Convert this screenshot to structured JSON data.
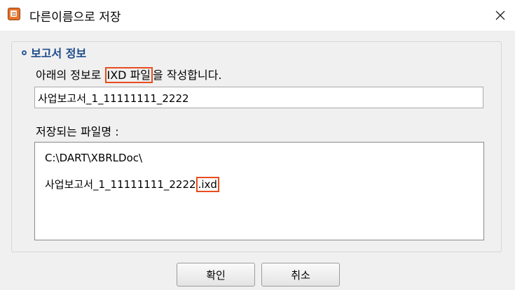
{
  "window": {
    "title": "다른이름으로 저장"
  },
  "group": {
    "label": "보고서 정보"
  },
  "description": {
    "prefix": "아래의 정보로 ",
    "highlight": "IXD 파일",
    "suffix": "을 작성합니다."
  },
  "report_name_field": {
    "value": "사업보고서_1_11111111_2222"
  },
  "saved_file": {
    "label": "저장되는 파일명 :",
    "path": "C:\\DART\\XBRLDoc\\",
    "name": "사업보고서_1_11111111_2222",
    "extension": ".ixd"
  },
  "buttons": {
    "ok": "확인",
    "cancel": "취소"
  },
  "colors": {
    "highlight_border": "#e84c1e",
    "group_label": "#1d4a8c"
  }
}
